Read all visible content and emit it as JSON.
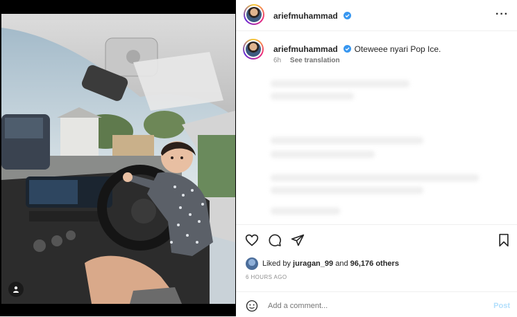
{
  "post": {
    "author": "ariefmuhammad",
    "caption_user": "ariefmuhammad",
    "caption_text": "Oteweee nyari Pop Ice.",
    "caption_age": "6h",
    "see_translation": "See translation",
    "more_icon": "more-horizontal-icon",
    "verified_icon": "verified-badge-icon",
    "tag_icon": "user-tag-icon"
  },
  "engagement": {
    "liked_by_prefix": "Liked by",
    "liked_by_user": "juragan_99",
    "and_word": "and",
    "others_count": "96,176 others",
    "posted_ago": "6 HOURS AGO",
    "icons": [
      "heart-icon",
      "comment-icon",
      "share-icon",
      "bookmark-icon"
    ]
  },
  "comment_bar": {
    "placeholder": "Add a comment...",
    "post_label": "Post",
    "emoji_icon": "emoji-icon"
  },
  "colors": {
    "verified": "#3897f0",
    "post_button_disabled": "#b2dffc",
    "muted_text": "#8e8e8e"
  }
}
